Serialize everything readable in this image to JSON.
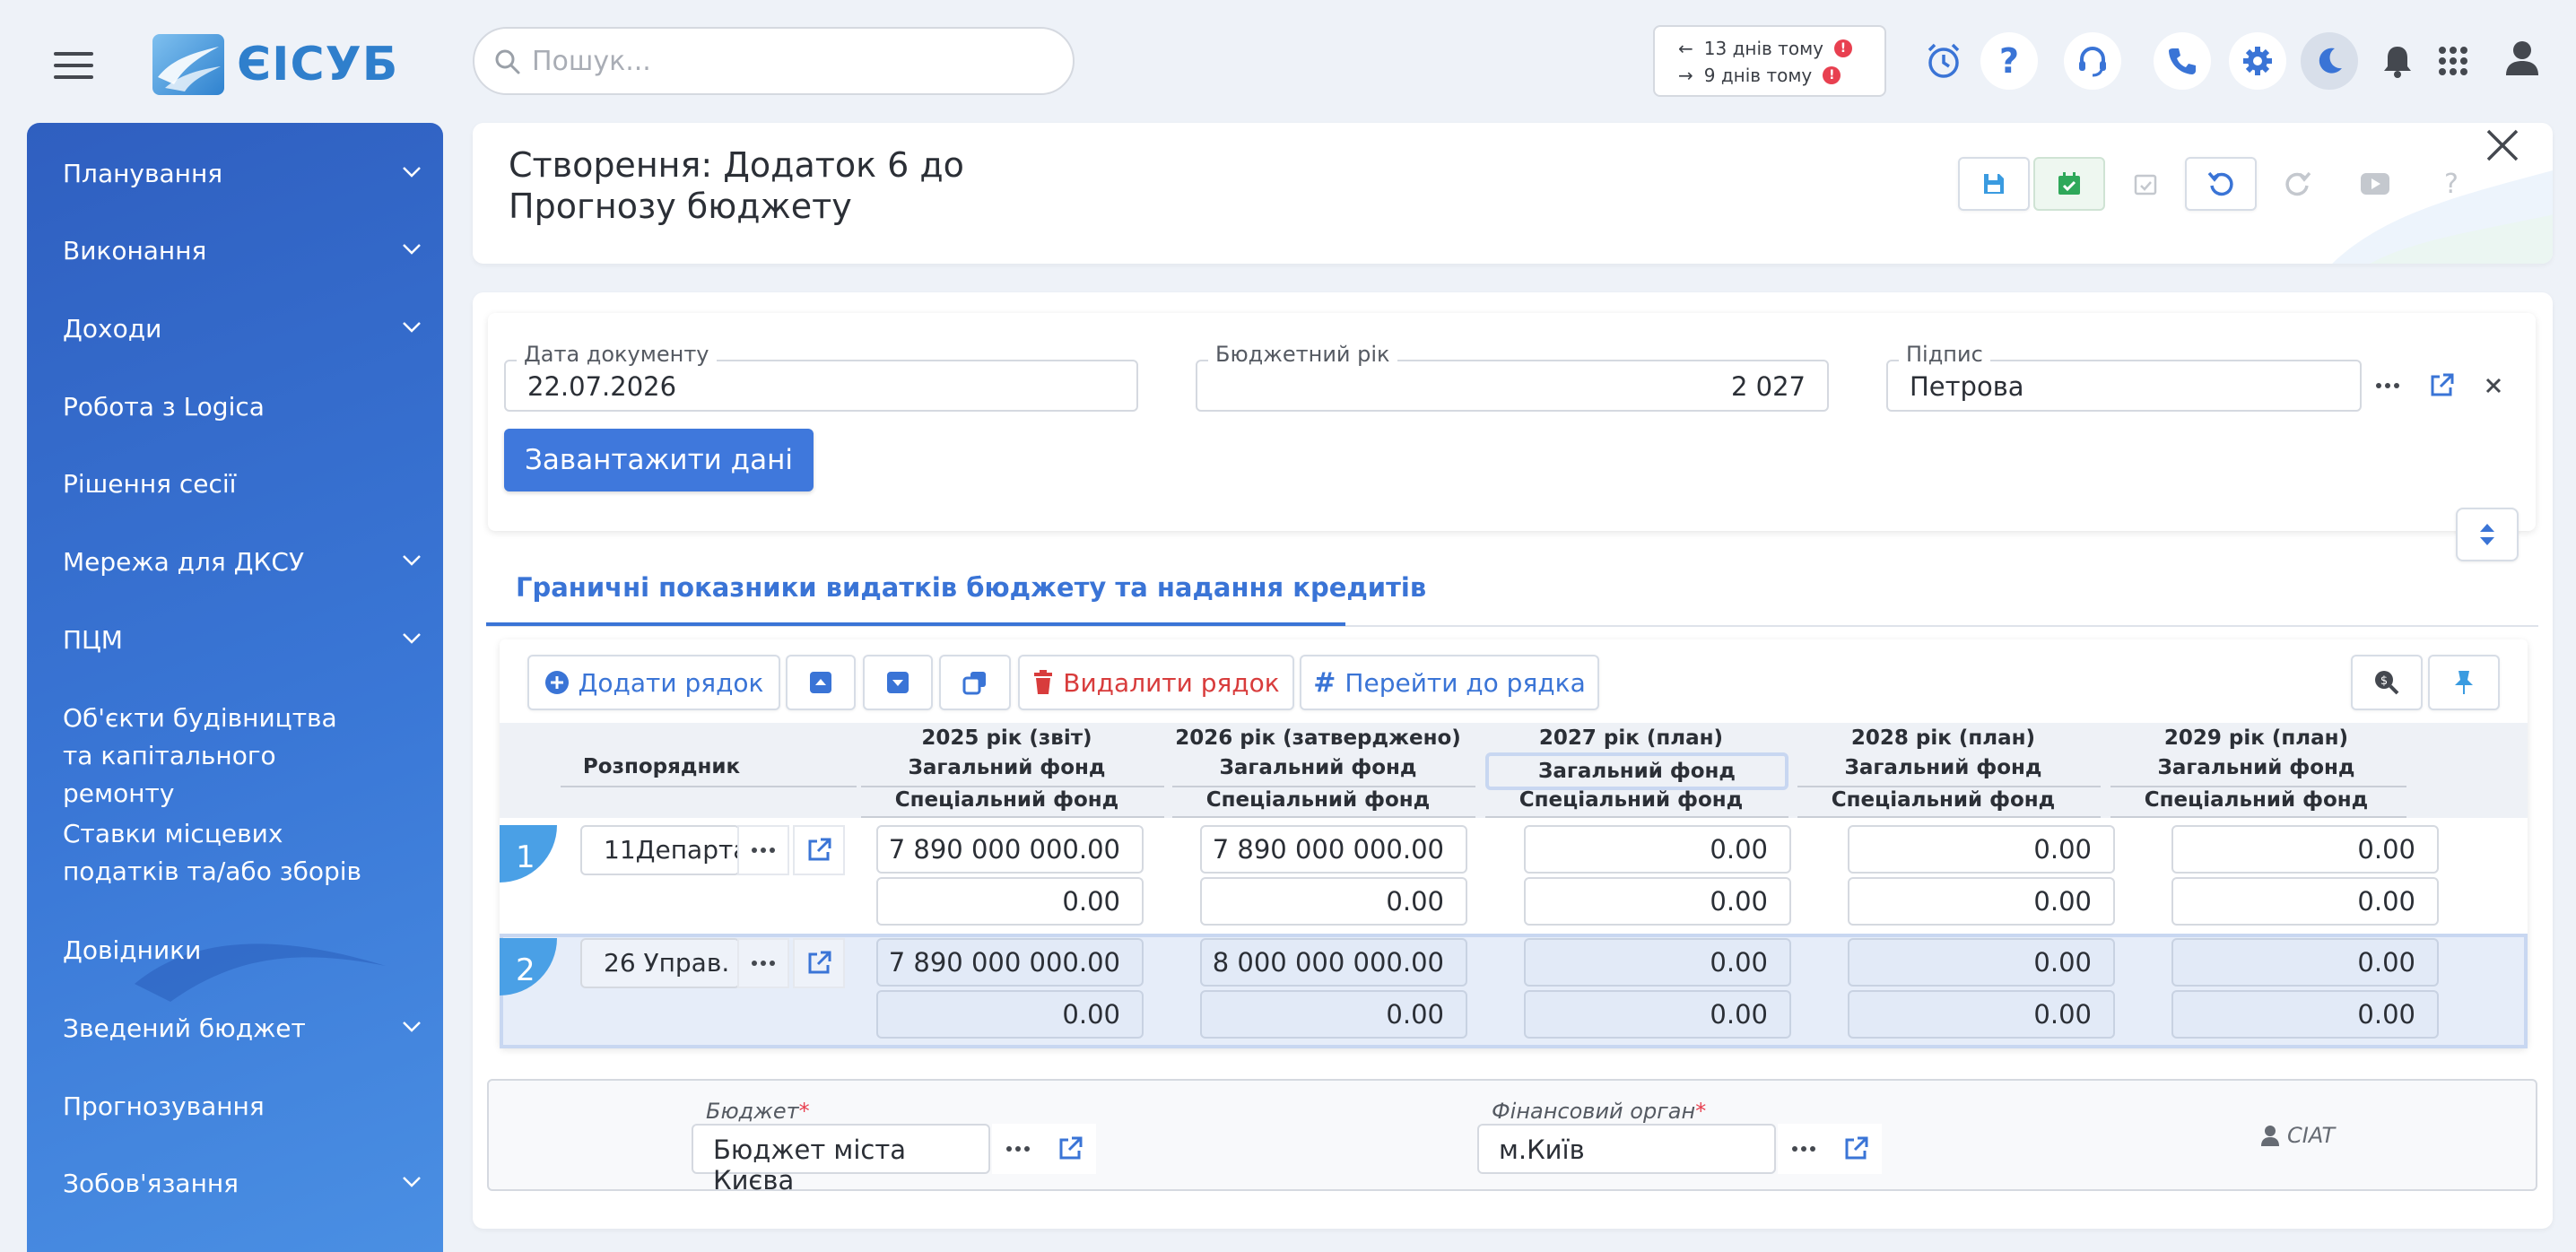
{
  "header": {
    "logo_text": "ЄІСУБ",
    "search": {
      "placeholder": "Пошук..."
    },
    "history": {
      "back": "13 днів тому",
      "forward": "9 днів тому",
      "badge": "!"
    },
    "icons": [
      "alarm-clock-icon",
      "help-icon",
      "headset-icon",
      "phone-icon",
      "gear-icon",
      "moon-icon",
      "bell-icon",
      "apps-grid-icon",
      "user-icon"
    ]
  },
  "sidebar": {
    "items": [
      {
        "label": "Планування",
        "expandable": true
      },
      {
        "label": "Виконання",
        "expandable": true
      },
      {
        "label": "Доходи",
        "expandable": true
      },
      {
        "label": "Робота з Logica",
        "expandable": false
      },
      {
        "label": "Рішення сесії",
        "expandable": false
      },
      {
        "label": "Мережа для ДКСУ",
        "expandable": true
      },
      {
        "label": "ПЦМ",
        "expandable": true
      },
      {
        "label": "Об'єкти будівництва та капітального ремонту",
        "expandable": false
      },
      {
        "label": "Ставки місцевих податків та/або зборів",
        "expandable": false
      },
      {
        "label": "Довідники",
        "expandable": false
      },
      {
        "label": "Зведений бюджет",
        "expandable": true
      },
      {
        "label": "Прогнозування",
        "expandable": false
      },
      {
        "label": "Зобов'язання",
        "expandable": true
      }
    ]
  },
  "document": {
    "title_line1": "Створення: Додаток 6 до",
    "title_line2": "Прогнозу бюджету",
    "toolbar": [
      "save-icon",
      "save-approve-icon",
      "approve-icon",
      "undo-icon",
      "redo-icon",
      "video-icon",
      "help-icon"
    ]
  },
  "form": {
    "date": {
      "label": "Дата документу",
      "value": "22.07.2026"
    },
    "budget_year": {
      "label": "Бюджетний рік",
      "value": "2 027"
    },
    "signature": {
      "label": "Підпис",
      "value": "Петрова"
    },
    "load_button": "Завантажити дані"
  },
  "tab": {
    "label": "Граничні показники видатків бюджету та надання кредитів"
  },
  "grid": {
    "buttons": {
      "add_row": "Додати рядок",
      "delete_row": "Видалити рядок",
      "goto_row": "Перейти до рядка"
    },
    "columns": {
      "manager": "Розпорядник",
      "years": [
        {
          "year": "2025 рік (звіт)",
          "general": "Загальний фонд",
          "special": "Спеціальний фонд"
        },
        {
          "year": "2026 рік (затверджено)",
          "general": "Загальний фонд",
          "special": "Спеціальний фонд"
        },
        {
          "year": "2027 рік (план)",
          "general": "Загальний фонд",
          "special": "Спеціальний фонд"
        },
        {
          "year": "2028 рік (план)",
          "general": "Загальний фонд",
          "special": "Спеціальний фонд"
        },
        {
          "year": "2029 рік (план)",
          "general": "Загальний фонд",
          "special": "Спеціальний фонд"
        }
      ]
    },
    "rows": [
      {
        "num": "1",
        "manager": "11Департа",
        "general": [
          "7 890 000 000.00",
          "7 890 000 000.00",
          "0.00",
          "0.00",
          "0.00"
        ],
        "special": [
          "0.00",
          "0.00",
          "0.00",
          "0.00",
          "0.00"
        ]
      },
      {
        "num": "2",
        "manager": "26 Управ.",
        "general": [
          "7 890 000 000.00",
          "8 000 000 000.00",
          "0.00",
          "0.00",
          "0.00"
        ],
        "special": [
          "0.00",
          "0.00",
          "0.00",
          "0.00",
          "0.00"
        ]
      }
    ]
  },
  "footer": {
    "budget": {
      "label": "Бюджет",
      "required": "*",
      "value": "Бюджет міста Києва"
    },
    "fin_organ": {
      "label": "Фінансовий орган",
      "required": "*",
      "value": "м.Київ"
    },
    "user": "CIAT"
  },
  "colors": {
    "accent": "#3a74d6",
    "sidebar_top": "#2f5fc0",
    "sidebar_bottom": "#4a8fe3",
    "danger": "#d83c3c",
    "selected_row": "#e6edf9"
  }
}
